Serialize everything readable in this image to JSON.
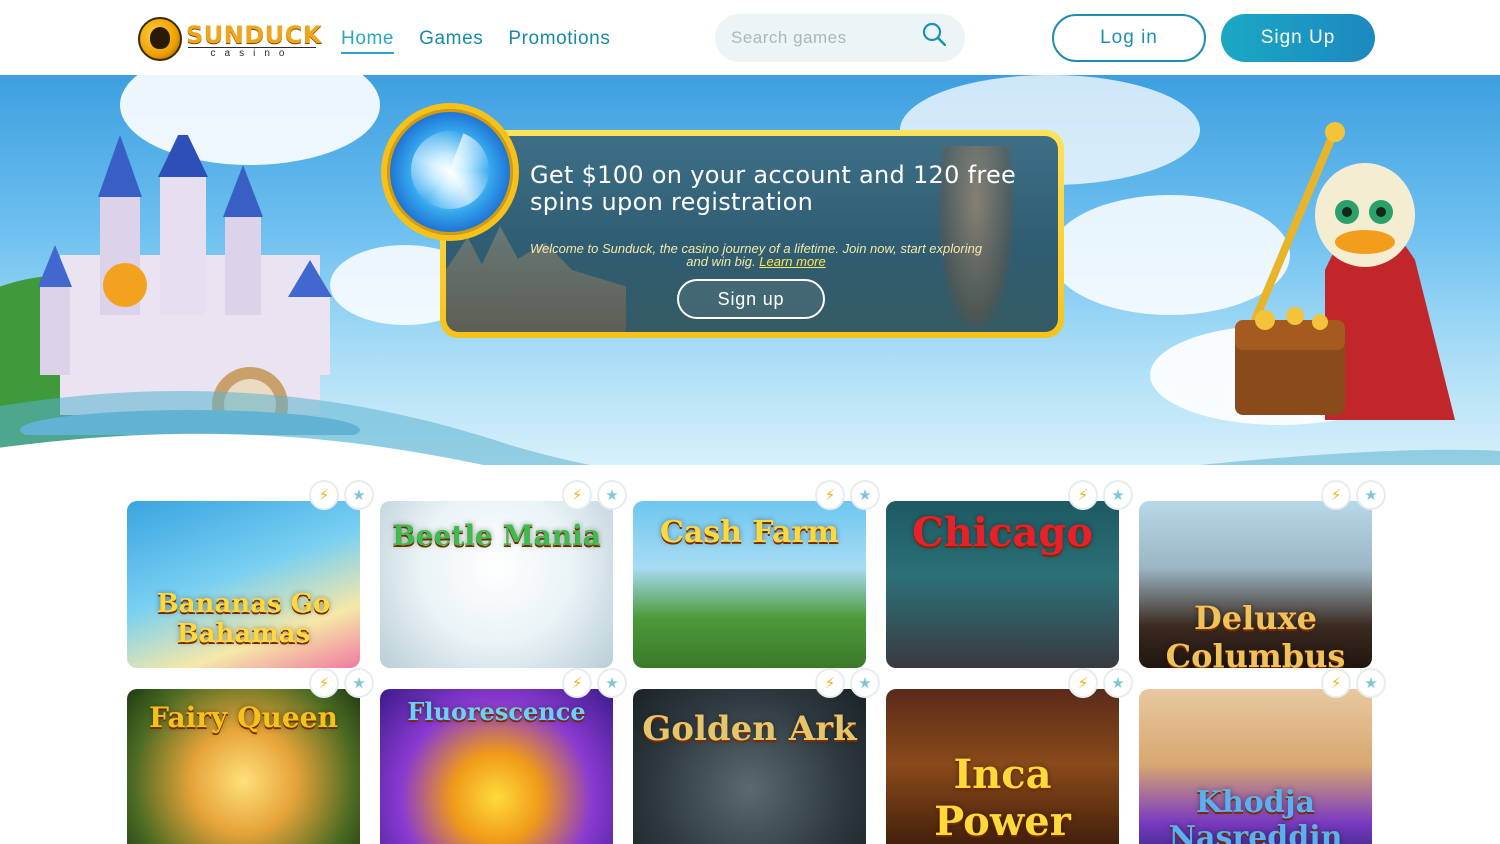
{
  "header": {
    "logo_text": "SUNDUCK",
    "logo_sub": "casino",
    "nav": [
      {
        "label": "Home",
        "active": true
      },
      {
        "label": "Games",
        "active": false
      },
      {
        "label": "Promotions",
        "active": false
      }
    ],
    "search_placeholder": "Search games",
    "login_label": "Log in",
    "signup_label": "Sign Up"
  },
  "promo": {
    "title": "Get $100 on your account and 120 free spins upon registration",
    "text": "Welcome to Sunduck, the casino journey of a lifetime. Join now, start exploring and win big.",
    "link_label": "Learn more",
    "button_label": "Sign up"
  },
  "games": [
    {
      "title": "Bananas Go Bahamas"
    },
    {
      "title": "Beetle Mania"
    },
    {
      "title": "Cash Farm"
    },
    {
      "title": "Chicago"
    },
    {
      "title": "Deluxe Columbus"
    },
    {
      "title": "Fairy Queen"
    },
    {
      "title": "Fluorescence"
    },
    {
      "title": "Golden Ark"
    },
    {
      "title": "Inca Power"
    },
    {
      "title": "Khodja Nasreddin"
    }
  ],
  "badges": {
    "bolt_icon": "lightning-icon",
    "star_icon": "star-icon"
  },
  "colors": {
    "accent": "#1d8fb0",
    "gold": "#f6c21a"
  }
}
